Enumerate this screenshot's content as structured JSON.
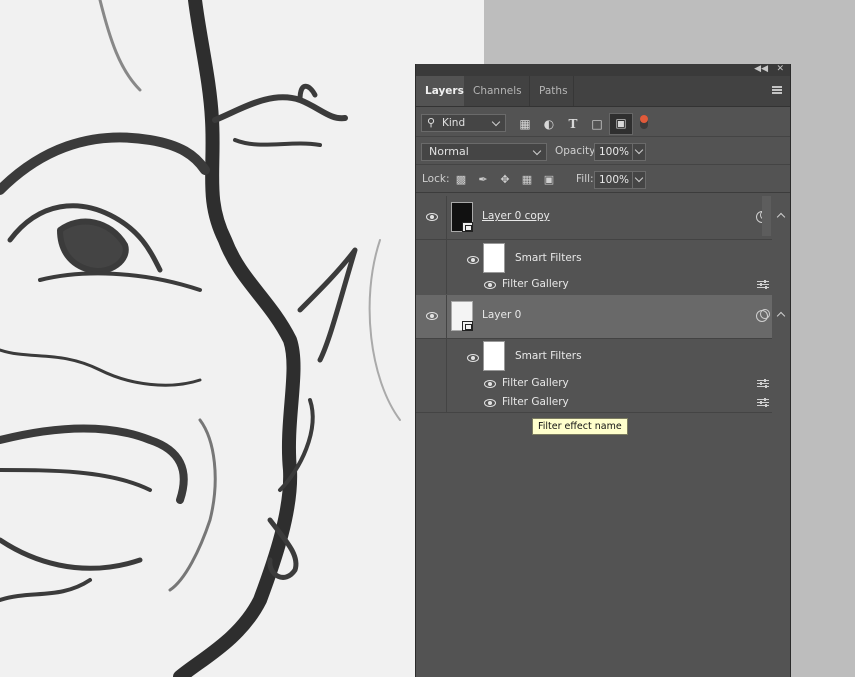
{
  "panel": {
    "tabs": [
      {
        "label": "Layers",
        "active": true
      },
      {
        "label": "Channels",
        "active": false
      },
      {
        "label": "Paths",
        "active": false
      }
    ],
    "filter": {
      "kind_label": "Kind"
    },
    "blend_mode": "Normal",
    "opacity_label": "Opacity:",
    "opacity_value": "100%",
    "lock_label": "Lock:",
    "fill_label": "Fill:",
    "fill_value": "100%"
  },
  "layers": [
    {
      "name": "Layer 0 copy",
      "selected": false,
      "smart_filters_label": "Smart Filters",
      "filters": [
        "Filter Gallery"
      ]
    },
    {
      "name": "Layer 0",
      "selected": true,
      "smart_filters_label": "Smart Filters",
      "filters": [
        "Filter Gallery",
        "Filter Gallery"
      ]
    }
  ],
  "tooltip": "Filter effect name",
  "colors": {
    "panel_bg": "#535353",
    "tab_bar": "#424242",
    "selected_row": "#696969",
    "tooltip_bg": "#ffffcc",
    "toggle_accent": "#e05a3a"
  }
}
